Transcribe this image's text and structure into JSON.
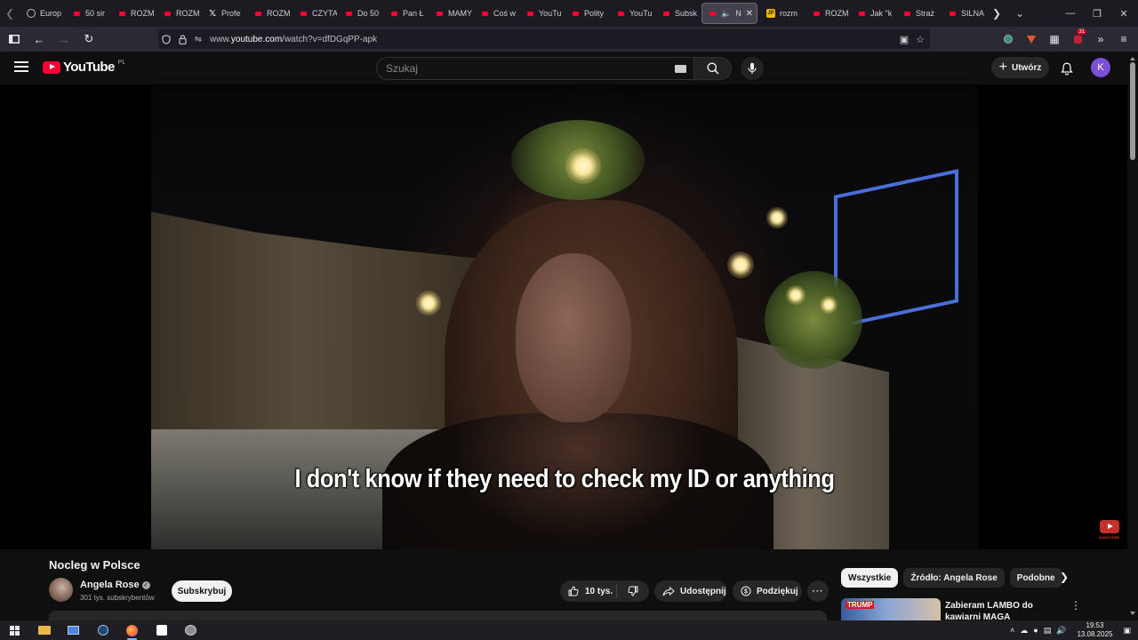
{
  "browser": {
    "tabs": [
      {
        "label": "Europ",
        "icon": "globe-icon"
      },
      {
        "label": "50 sir",
        "icon": "youtube-icon"
      },
      {
        "label": "ROZM",
        "icon": "youtube-icon"
      },
      {
        "label": "ROZM",
        "icon": "youtube-icon"
      },
      {
        "label": "Profe",
        "icon": "x-icon"
      },
      {
        "label": "ROZM",
        "icon": "youtube-icon"
      },
      {
        "label": "CZYTA",
        "icon": "youtube-icon"
      },
      {
        "label": "Do 50",
        "icon": "youtube-icon"
      },
      {
        "label": "Pan Ł",
        "icon": "youtube-icon"
      },
      {
        "label": "MAMY",
        "icon": "youtube-icon"
      },
      {
        "label": "Coś w",
        "icon": "youtube-icon"
      },
      {
        "label": "YouTu",
        "icon": "youtube-icon"
      },
      {
        "label": "Polity",
        "icon": "youtube-icon"
      },
      {
        "label": "YouTu",
        "icon": "youtube-icon"
      },
      {
        "label": "Subsk",
        "icon": "youtube-icon"
      }
    ],
    "active_tab": {
      "label": "No",
      "icon": "youtube-icon"
    },
    "tabs_after": [
      {
        "label": "rozm",
        "icon": "jp-icon"
      },
      {
        "label": "ROZM",
        "icon": "youtube-icon"
      },
      {
        "label": "Jak \"k",
        "icon": "youtube-icon"
      },
      {
        "label": "Straż",
        "icon": "youtube-icon"
      },
      {
        "label": "SILNA",
        "icon": "youtube-icon"
      }
    ],
    "url_prefix": "www.",
    "url_host": "youtube.com",
    "url_path": "/watch?v=dfDGqPP-apk",
    "extension_badge": "31"
  },
  "youtube": {
    "logo_text": "YouTube",
    "region": "PL",
    "search_placeholder": "Szukaj",
    "create_label": "Utwórz",
    "avatar_letter": "K",
    "caption": "I don't know if they need to check my ID or anything",
    "watermark_text": "SUBSCRIBE",
    "video_title": "Nocleg w Polsce",
    "channel_name": "Angela Rose",
    "subscribers": "301 tys. subskrybentów",
    "subscribe_label": "Subskrybuj",
    "likes": "10 tys.",
    "share_label": "Udostępnij",
    "thanks_label": "Podziękuj",
    "chips": [
      "Wszystkie",
      "Źródło: Angela Rose",
      "Podobne"
    ],
    "recommended": {
      "thumb_text": "TRUMP",
      "title": "Zabieram LAMBO do kawiarni MAGA"
    }
  },
  "taskbar": {
    "time": "19:53",
    "date": "13.08.2025"
  },
  "colors": {
    "youtube_red": "#ff0033",
    "avatar_purple": "#7b4fd6",
    "page_bg": "#0f0f0f"
  }
}
